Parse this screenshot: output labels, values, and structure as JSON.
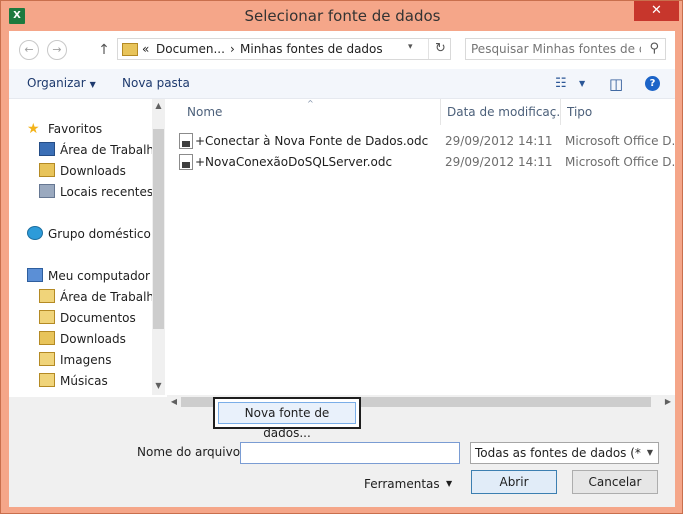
{
  "window": {
    "title": "Selecionar fonte de dados",
    "app_icon_text": "X",
    "close_label": "✕"
  },
  "address": {
    "back_icon": "←",
    "forward_icon": "→",
    "up_icon": "↑",
    "overflow": "«",
    "crumb1": "Documen...",
    "separator": "›",
    "crumb2": "Minhas fontes de dados",
    "dropdown_icon": "▾",
    "refresh_icon": "↻"
  },
  "search": {
    "placeholder": "Pesquisar Minhas fontes de do...",
    "icon": "⚲"
  },
  "toolbar": {
    "organize_label": "Organizar",
    "organize_arrow": "▼",
    "new_folder_label": "Nova pasta",
    "view_icon": "☷",
    "view_arrow": "▼",
    "preview_icon": "◫",
    "help_icon": "?"
  },
  "navigation": {
    "favorites": "Favoritos",
    "items_fav": [
      "Área de Trabalho",
      "Downloads",
      "Locais recentes"
    ],
    "homegroup": "Grupo doméstico",
    "computer": "Meu computador",
    "items_pc": [
      "Área de Trabalho",
      "Documentos",
      "Downloads",
      "Imagens",
      "Músicas"
    ]
  },
  "columns": {
    "name": "Nome",
    "date": "Data de modificaç...",
    "type": "Tipo",
    "sort_indicator": "^"
  },
  "files": [
    {
      "name": "+Conectar à Nova Fonte de Dados.odc",
      "date": "29/09/2012 14:11",
      "type": "Microsoft Office D..."
    },
    {
      "name": "+NovaConexãoDoSQLServer.odc",
      "date": "29/09/2012 14:11",
      "type": "Microsoft Office D..."
    }
  ],
  "scroll": {
    "up": "▲",
    "down": "▼",
    "left": "◀",
    "right": "▶"
  },
  "bottom": {
    "new_source_button": "Nova fonte de dados...",
    "filename_label": "Nome do arquivo:",
    "filename_value": "",
    "filter_value": "Todas as fontes de dados (*.odc",
    "filter_arrow": "▼",
    "tools_label": "Ferramentas",
    "tools_arrow": "▼",
    "open_button": "Abrir",
    "cancel_button": "Cancelar"
  }
}
